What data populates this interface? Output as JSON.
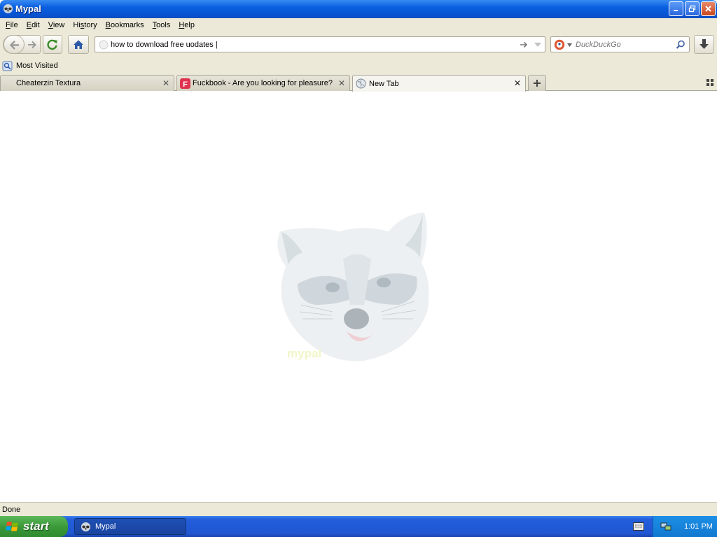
{
  "window": {
    "title": "Mypal",
    "minimize_icon": "minimize-icon",
    "restore_icon": "restore-icon",
    "close_icon": "close-icon"
  },
  "menu": {
    "items": [
      {
        "label": "File",
        "key": "F"
      },
      {
        "label": "Edit",
        "key": "E"
      },
      {
        "label": "View",
        "key": "V"
      },
      {
        "label": "History",
        "key": "s"
      },
      {
        "label": "Bookmarks",
        "key": "B"
      },
      {
        "label": "Tools",
        "key": "T"
      },
      {
        "label": "Help",
        "key": "H"
      }
    ]
  },
  "nav": {
    "url_value": "how to download free uodates |",
    "search_placeholder": "DuckDuckGo"
  },
  "bookmarks": {
    "most_visited": "Most Visited"
  },
  "tabs": [
    {
      "label": "Cheaterzin Textura",
      "selected": false
    },
    {
      "label": "Fuckbook - Are you looking for pleasure?",
      "selected": false
    },
    {
      "label": "New Tab",
      "selected": true
    }
  ],
  "content": {
    "logo_text": "mypal"
  },
  "status": {
    "text": "Done"
  },
  "taskbar": {
    "start_label": "start",
    "task_label": "Mypal",
    "clock": "1:01 PM"
  },
  "colors": {
    "titlebar": "#0a5fe0",
    "chrome": "#ece9d8",
    "taskbar": "#245edb",
    "start": "#3c9a3a"
  }
}
